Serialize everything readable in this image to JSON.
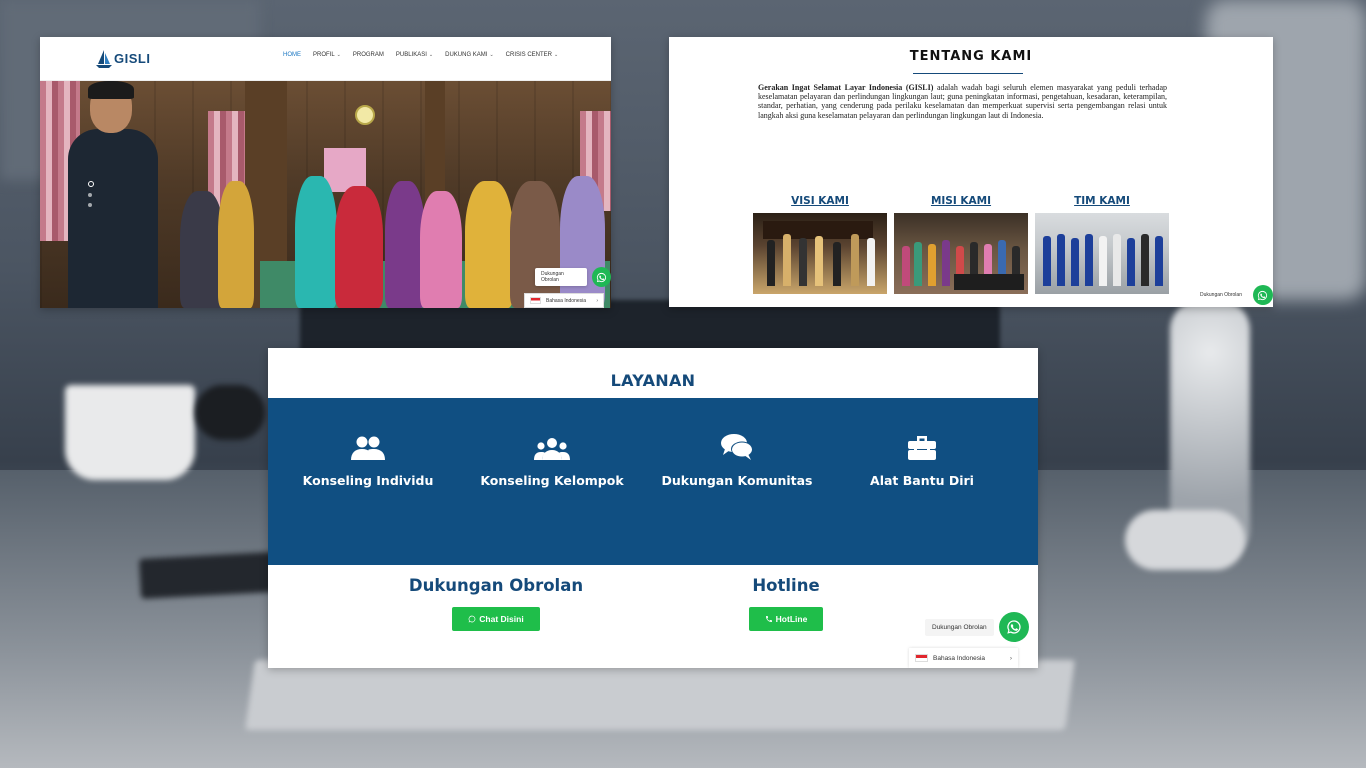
{
  "home": {
    "logo_text": "GISLI",
    "nav": [
      {
        "label": "HOME",
        "dropdown": false,
        "active": true
      },
      {
        "label": "PROFIL",
        "dropdown": true,
        "active": false
      },
      {
        "label": "PROGRAM",
        "dropdown": false,
        "active": false
      },
      {
        "label": "PUBLIKASI",
        "dropdown": true,
        "active": false
      },
      {
        "label": "DUKUNG KAMI",
        "dropdown": true,
        "active": false
      },
      {
        "label": "CRISIS CENTER",
        "dropdown": true,
        "active": false
      }
    ],
    "whatsapp_label": "Dukungan Obrolan",
    "language": "Bahasa Indonesia"
  },
  "about": {
    "title": "TENTANG KAMI",
    "org_name": "Gerakan Ingat Selamat Layar Indonesia (GISLI)",
    "description": "adalah wadah bagi seluruh elemen masyarakat yang peduli terhadap keselamatan pelayaran dan perlindungan lingkungan laut; guna peningkatan informasi, pengetahuan, kesadaran, keterampilan, standar, perhatian, yang cenderung pada perilaku keselamatan dan memperkuat supervisi serta pengembangan relasi untuk langkah aksi guna keselamatan pelayaran dan perlindungan lingkungan laut di Indonesia.",
    "cards": [
      {
        "label": "VISI KAMI"
      },
      {
        "label": "MISI KAMI"
      },
      {
        "label": "TIM KAMI"
      }
    ],
    "whatsapp_label": "Dukungan Obrolan"
  },
  "services": {
    "title": "LAYANAN",
    "items": [
      {
        "label": "Konseling Individu",
        "icon": "users-icon"
      },
      {
        "label": "Konseling Kelompok",
        "icon": "group-icon"
      },
      {
        "label": "Dukungan Komunitas",
        "icon": "comments-icon"
      },
      {
        "label": "Alat Bantu Diri",
        "icon": "toolbox-icon"
      }
    ],
    "chat": {
      "heading": "Dukungan Obrolan",
      "button": "Chat Disini"
    },
    "hotline": {
      "heading": "Hotline",
      "button": "HotLine"
    },
    "whatsapp_label": "Dukungan Obrolan",
    "language": "Bahasa Indonesia"
  },
  "colors": {
    "brand_blue": "#104f82",
    "heading_blue": "#154a7a",
    "whatsapp_green": "#1fb855",
    "button_green": "#1fbe4a"
  }
}
